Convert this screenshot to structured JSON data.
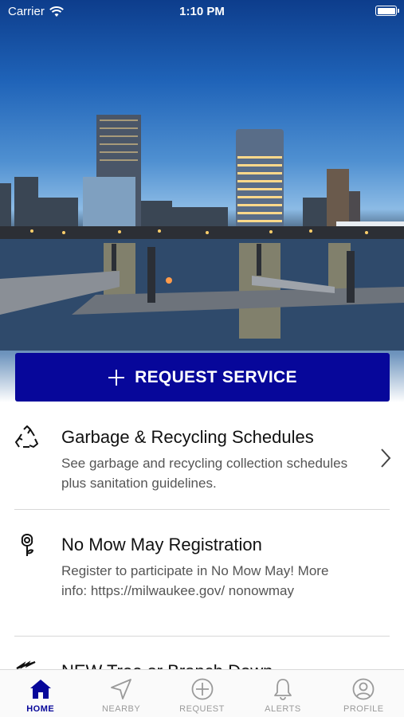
{
  "status_bar": {
    "carrier": "Carrier",
    "time": "1:10 PM",
    "wifi_icon": "wifi-icon",
    "battery_icon": "battery-icon"
  },
  "hero": {
    "image": "city-skyline-waterfront-photo"
  },
  "request_button": {
    "label": "REQUEST SERVICE",
    "icon": "plus-icon",
    "color": "#07079a"
  },
  "list": [
    {
      "title": "Garbage & Recycling Schedules",
      "description": "See garbage and recycling collection schedules plus sanitation guidelines.",
      "icon": "recycle-icon"
    },
    {
      "title": "No Mow May Registration",
      "description": "Register to participate in No Mow May! More info: https://milwaukee.gov/ nonowmay",
      "icon": "flower-icon"
    },
    {
      "title": "NEW Tree or Branch Down",
      "description": "",
      "icon": "fallen-tree-icon"
    }
  ],
  "tabs": [
    {
      "label": "HOME",
      "icon": "home-icon",
      "active": true
    },
    {
      "label": "NEARBY",
      "icon": "location-arrow-icon",
      "active": false
    },
    {
      "label": "REQUEST",
      "icon": "plus-circle-icon",
      "active": false
    },
    {
      "label": "ALERTS",
      "icon": "bell-icon",
      "active": false
    },
    {
      "label": "PROFILE",
      "icon": "person-icon",
      "active": false
    }
  ],
  "colors": {
    "accent": "#07079a",
    "inactive_tab": "#9a9a9a",
    "divider": "#d8d8d8"
  }
}
